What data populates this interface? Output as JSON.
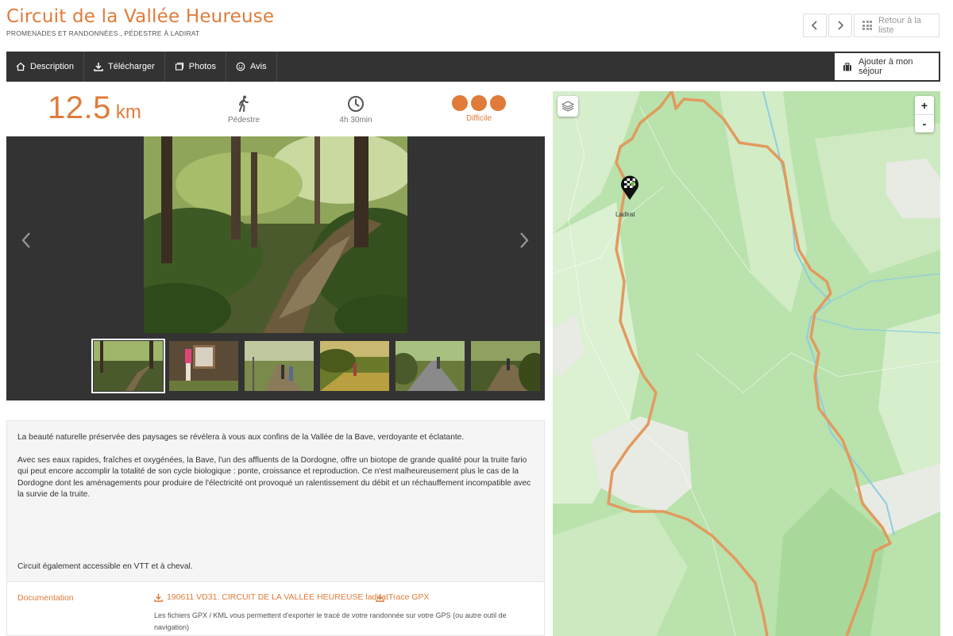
{
  "header": {
    "title": "Circuit de la Vallée Heureuse",
    "subtitle": "PROMENADES ET RANDONNÉES ,  PÉDESTRE À LADIRAT",
    "back_label": "Retour à la liste",
    "prev_icon": "chevron-left-icon",
    "next_icon": "chevron-right-icon"
  },
  "tabs": [
    {
      "label": "Description",
      "icon": "home-icon"
    },
    {
      "label": "Télécharger",
      "icon": "download-icon"
    },
    {
      "label": "Photos",
      "icon": "photos-icon"
    },
    {
      "label": "Avis",
      "icon": "smiley-icon"
    }
  ],
  "sejour_label": "Ajouter à mon séjour",
  "stats": {
    "distance_value": "12.5",
    "distance_unit": "km",
    "mode": "Pédestre",
    "duration": "4h 30min",
    "difficulty": "Difficile",
    "difficulty_level": 3
  },
  "gallery": {
    "thumbnail_count": 6,
    "active_index": 0
  },
  "description": {
    "p1": "La beauté naturelle préservée des paysages se révèlera à vous aux confins de la Vallée de la Bave, verdoyante et éclatante.",
    "p2": "Avec ses eaux rapides, fraîches et oxygénées, la Bave, l'un des affluents de la Dordogne, offre un biotope de grande qualité pour la truite fario qui peut encore accomplir la totalité de son cycle biologique : ponte, croissance et reproduction. Ce n'est malheureusement plus le cas de la Dordogne dont les aménagements pour produire de l'électricité ont provoqué un ralentissement du débit et un réchauffement incompatible avec la survie de la truite.",
    "p3": "Circuit également accessible en VTT et à cheval."
  },
  "documentation": {
    "label": "Documentation",
    "file1": "190611 VD31. CIRCUIT DE LA VALLÉE HEUREUSE ladirat",
    "file2": "Trace GPX",
    "note": "Les fichiers GPX / KML vous permettent d'exporter le tracé de votre randonnée sur votre GPS (ou autre outil de navigation)"
  },
  "map": {
    "marker_label": "Ladirat",
    "zoom_in": "+",
    "zoom_out": "-",
    "route_color": "#e29a5e"
  },
  "colors": {
    "accent": "#e07b39",
    "dark_bar": "#333333"
  }
}
